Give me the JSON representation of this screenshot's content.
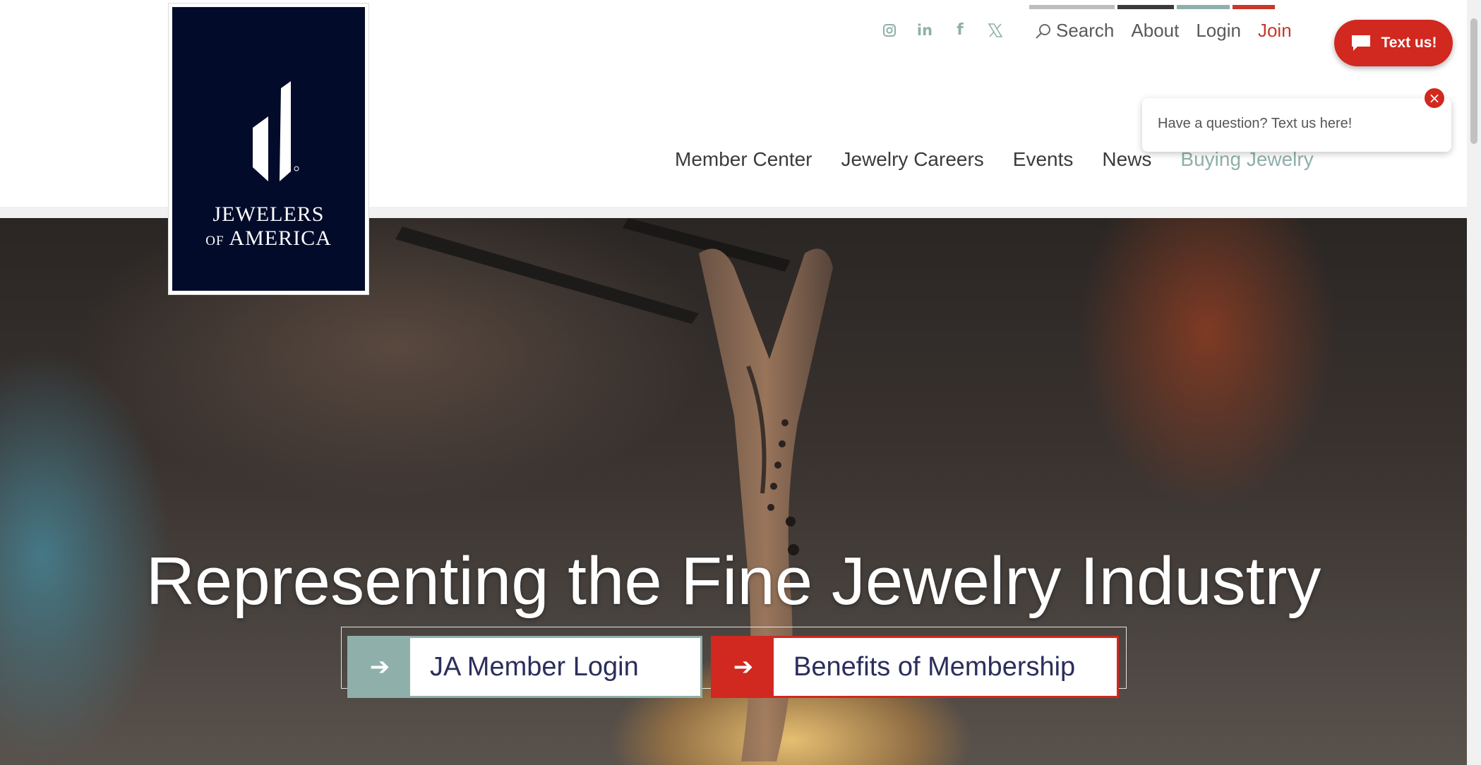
{
  "header": {
    "logo": {
      "line1": "JEWELERS",
      "line2_small": "OF",
      "line2": "AMERICA"
    },
    "color_bars": [
      "#bdbdbd",
      "#3a3a3a",
      "#8fb0aa",
      "#c8372a"
    ],
    "social_icons": [
      "instagram-icon",
      "linkedin-icon",
      "facebook-icon",
      "x-icon"
    ],
    "util_nav": {
      "search": "Search",
      "about": "About",
      "login": "Login",
      "join": "Join"
    },
    "main_nav": [
      "Member Center",
      "Jewelry Careers",
      "Events",
      "News",
      "Buying Jewelry"
    ],
    "active_nav": "Buying Jewelry"
  },
  "chat": {
    "button_label": "Text us!",
    "popup_text": "Have a question? Text us here!",
    "close_icon": "×"
  },
  "hero": {
    "headline": "Representing the Fine Jewelry Industry",
    "cta": [
      {
        "label": "JA Member Login",
        "color": "#8fb0aa"
      },
      {
        "label": "Benefits of Membership",
        "color": "#d1281f"
      }
    ]
  },
  "colors": {
    "navy": "#020b2a",
    "sage": "#8fb0aa",
    "red": "#d1281f"
  }
}
